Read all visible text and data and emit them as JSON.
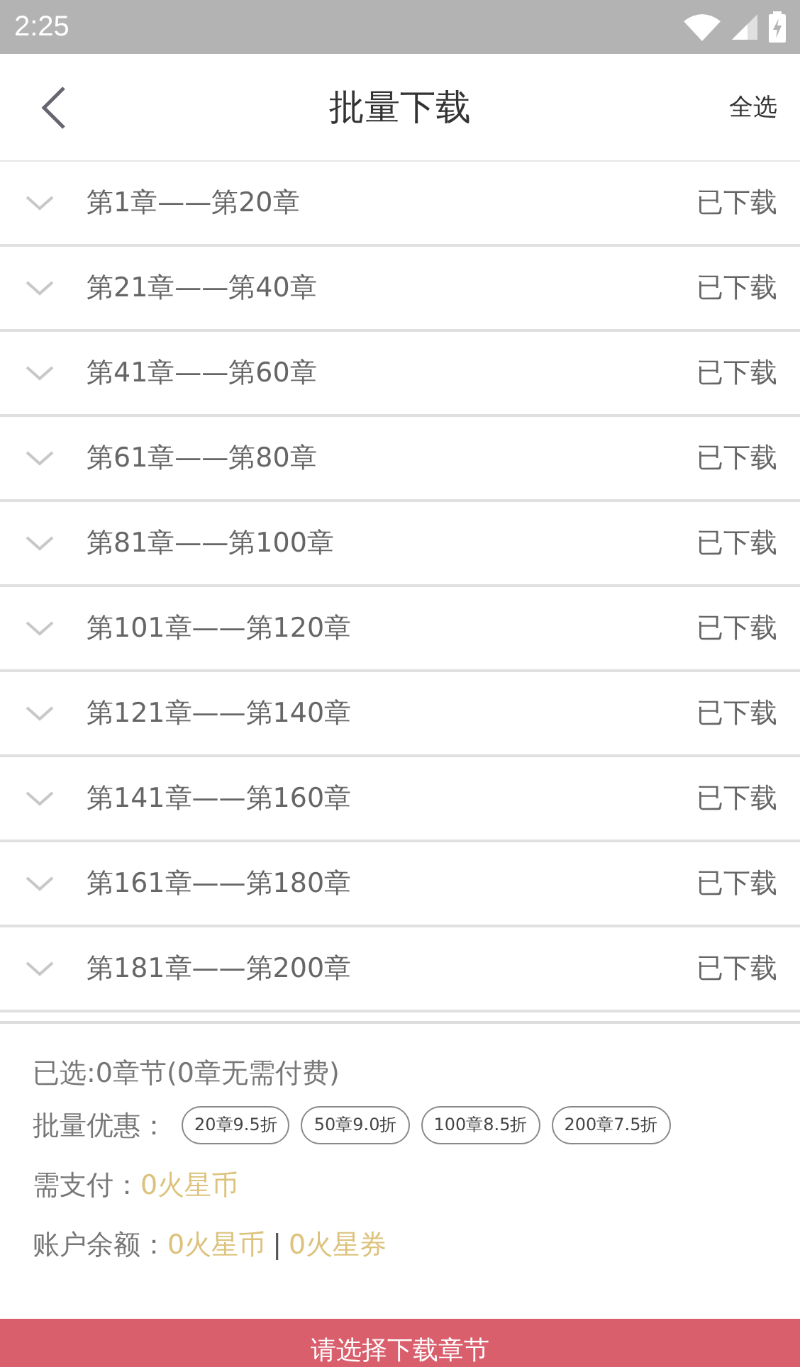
{
  "status_bar": {
    "time": "2:25"
  },
  "header": {
    "title": "批量下载",
    "action": "全选"
  },
  "chapters": [
    {
      "title": "第1章——第20章",
      "status": "已下载"
    },
    {
      "title": "第21章——第40章",
      "status": "已下载"
    },
    {
      "title": "第41章——第60章",
      "status": "已下载"
    },
    {
      "title": "第61章——第80章",
      "status": "已下载"
    },
    {
      "title": "第81章——第100章",
      "status": "已下载"
    },
    {
      "title": "第101章——第120章",
      "status": "已下载"
    },
    {
      "title": "第121章——第140章",
      "status": "已下载"
    },
    {
      "title": "第141章——第160章",
      "status": "已下载"
    },
    {
      "title": "第161章——第180章",
      "status": "已下载"
    },
    {
      "title": "第181章——第200章",
      "status": "已下载"
    }
  ],
  "summary": {
    "selected": "已选:0章节(0章无需付费)",
    "discount_label": "批量优惠：",
    "discounts": [
      "20章9.5折",
      "50章9.0折",
      "100章8.5折",
      "200章7.5折"
    ],
    "pay_label": "需支付：",
    "pay_value": "0火星币",
    "balance_label": "账户余额：",
    "balance_coins": "0火星币",
    "separator": "|",
    "balance_vouchers": "0火星券"
  },
  "button": "请选择下载章节"
}
